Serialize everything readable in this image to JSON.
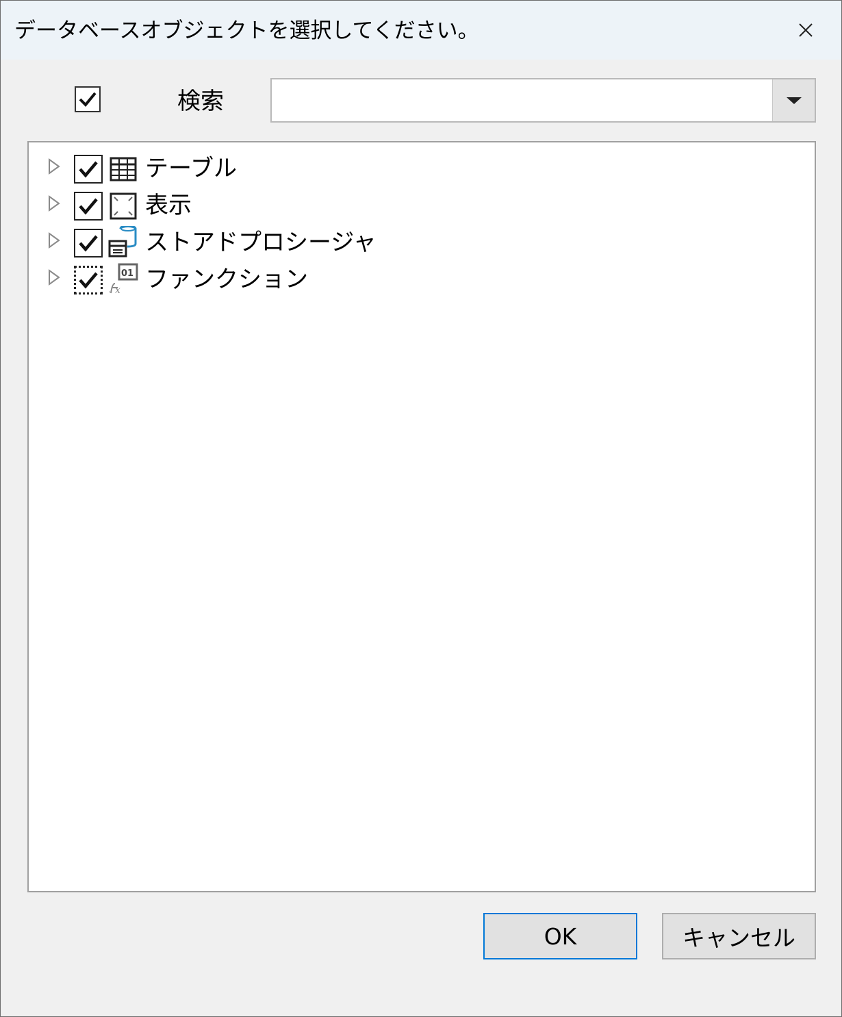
{
  "dialog": {
    "title": "データベースオブジェクトを選択してください。",
    "close_icon": "close-icon"
  },
  "search": {
    "checked": true,
    "label": "検索",
    "value": "",
    "dropdown_icon": "dropdown-arrow-icon"
  },
  "tree": {
    "items": [
      {
        "label": "テーブル",
        "checked": true,
        "partial": false,
        "icon": "table-icon",
        "expanded": false
      },
      {
        "label": "表示",
        "checked": true,
        "partial": false,
        "icon": "view-icon",
        "expanded": false
      },
      {
        "label": "ストアドプロシージャ",
        "checked": true,
        "partial": false,
        "icon": "stored-procedure-icon",
        "expanded": false
      },
      {
        "label": "ファンクション",
        "checked": true,
        "partial": true,
        "icon": "function-icon",
        "expanded": false
      }
    ]
  },
  "buttons": {
    "ok": "OK",
    "cancel": "キャンセル"
  },
  "colors": {
    "titlebar": "#edf3f8",
    "dialog_bg": "#f0f0f0",
    "accent": "#0078d7",
    "procedure_icon": "#2a8cc4"
  }
}
